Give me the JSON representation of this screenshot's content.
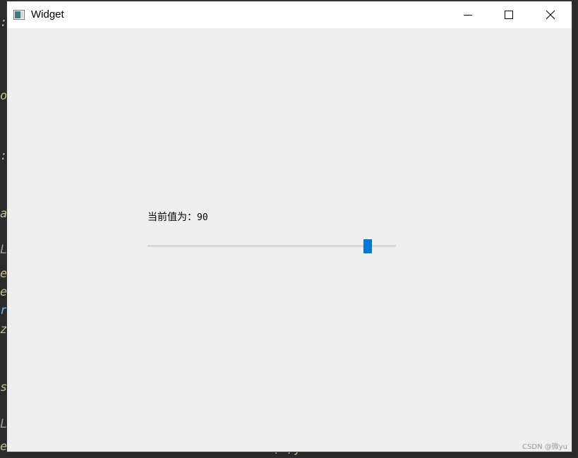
{
  "window": {
    "title": "Widget",
    "icon": "qt-window-icon",
    "controls": {
      "minimize": "minimize-icon",
      "maximize": "maximize-icon",
      "close": "close-icon"
    }
  },
  "content": {
    "label_prefix": "当前值为：",
    "slider_value": "90",
    "slider": {
      "value": 90,
      "min": 0,
      "max": 100
    }
  },
  "watermark": "CSDN @微yu",
  "background_fragments": [
    ":",
    "o",
    ":",
    "a",
    "L",
    "e",
    "e",
    "r",
    "zo",
    "s",
    "L",
    "e",
    "( )y"
  ],
  "colors": {
    "accent": "#0078d7",
    "window_bg": "#efefef",
    "titlebar_bg": "#ffffff"
  }
}
